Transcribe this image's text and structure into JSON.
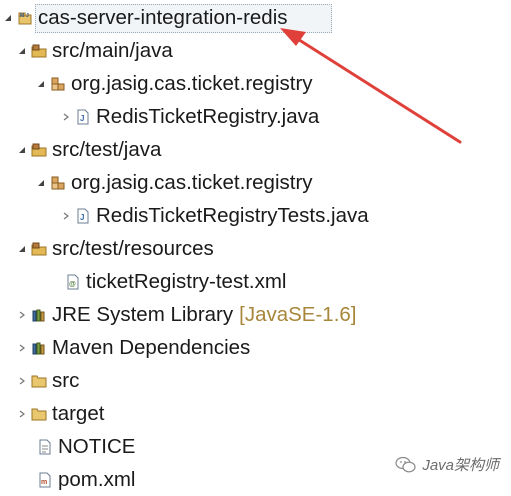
{
  "project_explorer": {
    "root": {
      "label": "cas-server-integration-redis",
      "icon": "maven-project-icon",
      "expanded": true
    },
    "items": [
      {
        "label": "src/main/java",
        "icon": "source-folder-icon",
        "expanded": true
      },
      {
        "label": "org.jasig.cas.ticket.registry",
        "icon": "package-icon",
        "expanded": true
      },
      {
        "label": "RedisTicketRegistry.java",
        "icon": "java-file-icon",
        "expanded": false
      },
      {
        "label": "src/test/java",
        "icon": "source-folder-icon",
        "expanded": true
      },
      {
        "label": "org.jasig.cas.ticket.registry",
        "icon": "package-icon",
        "expanded": true
      },
      {
        "label": "RedisTicketRegistryTests.java",
        "icon": "java-file-icon",
        "expanded": false
      },
      {
        "label": "src/test/resources",
        "icon": "source-folder-icon",
        "expanded": true
      },
      {
        "label": "ticketRegistry-test.xml",
        "icon": "xml-file-icon"
      },
      {
        "label": "JRE System Library",
        "decoration": "[JavaSE-1.6]",
        "icon": "library-icon",
        "expanded": false
      },
      {
        "label": "Maven Dependencies",
        "icon": "library-icon",
        "expanded": false
      },
      {
        "label": "src",
        "icon": "folder-icon",
        "expanded": false
      },
      {
        "label": "target",
        "icon": "folder-icon",
        "expanded": false
      },
      {
        "label": "NOTICE",
        "icon": "text-file-icon"
      },
      {
        "label": "pom.xml",
        "icon": "pom-file-icon"
      }
    ]
  },
  "watermark": {
    "text": "Java架构师",
    "icon": "wechat-icon"
  },
  "colors": {
    "arrow": "#e0403a",
    "decoration": "#a8863a",
    "selection_border": "#9aa7b5"
  }
}
